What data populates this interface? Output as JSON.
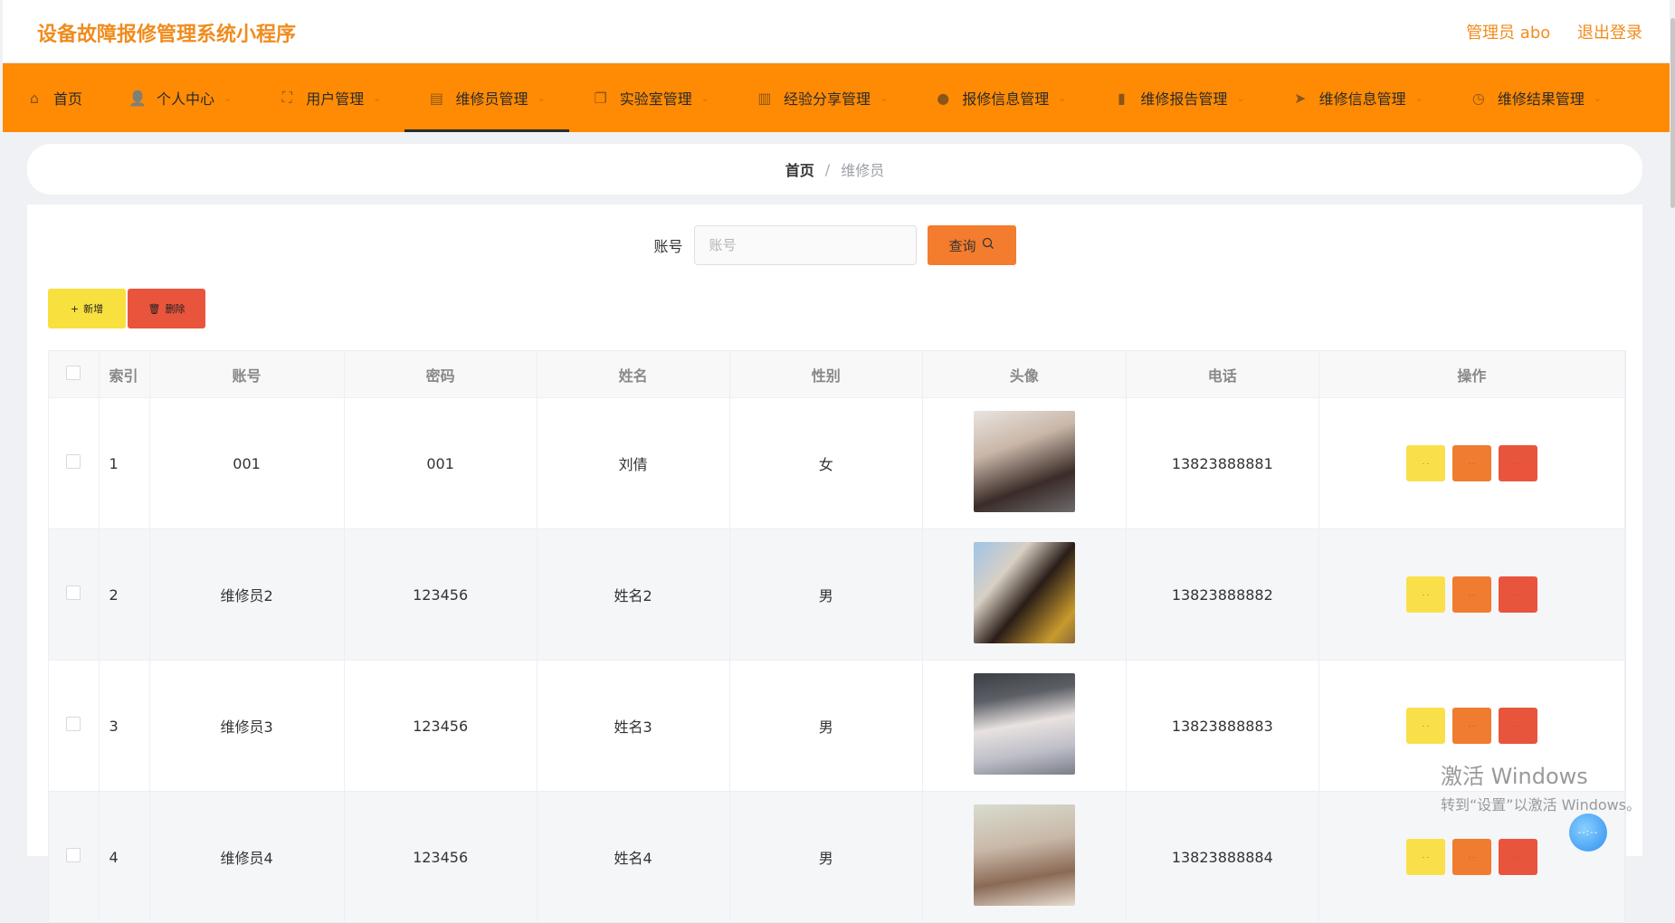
{
  "app": {
    "title": "设备故障报修管理系统小程序"
  },
  "header": {
    "user_label": "管理员 abo",
    "logout_label": "退出登录"
  },
  "nav": {
    "items": [
      {
        "label": "首页",
        "icon": "home-icon"
      },
      {
        "label": "个人中心",
        "icon": "user-icon"
      },
      {
        "label": "用户管理",
        "icon": "users-icon"
      },
      {
        "label": "维修员管理",
        "icon": "clipboard-icon"
      },
      {
        "label": "实验室管理",
        "icon": "lab-icon"
      },
      {
        "label": "经验分享管理",
        "icon": "share-icon"
      },
      {
        "label": "报修信息管理",
        "icon": "message-icon"
      },
      {
        "label": "维修报告管理",
        "icon": "report-icon"
      },
      {
        "label": "维修信息管理",
        "icon": "send-icon"
      },
      {
        "label": "维修结果管理",
        "icon": "result-icon"
      }
    ],
    "active_index": 3
  },
  "breadcrumb": {
    "home": "首页",
    "separator": "/",
    "current": "维修员"
  },
  "search": {
    "label": "账号",
    "placeholder": "账号",
    "value": "",
    "button_label": "查询"
  },
  "actions": {
    "add_label": "新增",
    "delete_label": "删除"
  },
  "table": {
    "headers": [
      "索引",
      "账号",
      "密码",
      "姓名",
      "性别",
      "头像",
      "电话",
      "操作"
    ],
    "rows": [
      {
        "index": "1",
        "account": "001",
        "password": "001",
        "name": "刘倩",
        "gender": "女",
        "phone": "13823888881"
      },
      {
        "index": "2",
        "account": "维修员2",
        "password": "123456",
        "name": "姓名2",
        "gender": "男",
        "phone": "13823888882"
      },
      {
        "index": "3",
        "account": "维修员3",
        "password": "123456",
        "name": "姓名3",
        "gender": "男",
        "phone": "13823888883"
      },
      {
        "index": "4",
        "account": "维修员4",
        "password": "123456",
        "name": "姓名4",
        "gender": "男",
        "phone": "13823888884"
      }
    ]
  },
  "watermark": {
    "line1": "激活 Windows",
    "line2": "转到“设置”以激活 Windows。"
  },
  "colors": {
    "accent": "#f08c1e",
    "nav_bg": "#ff8b04",
    "btn_yellow": "#f9e04a",
    "btn_orange": "#f07c30",
    "btn_red": "#e9553c"
  }
}
